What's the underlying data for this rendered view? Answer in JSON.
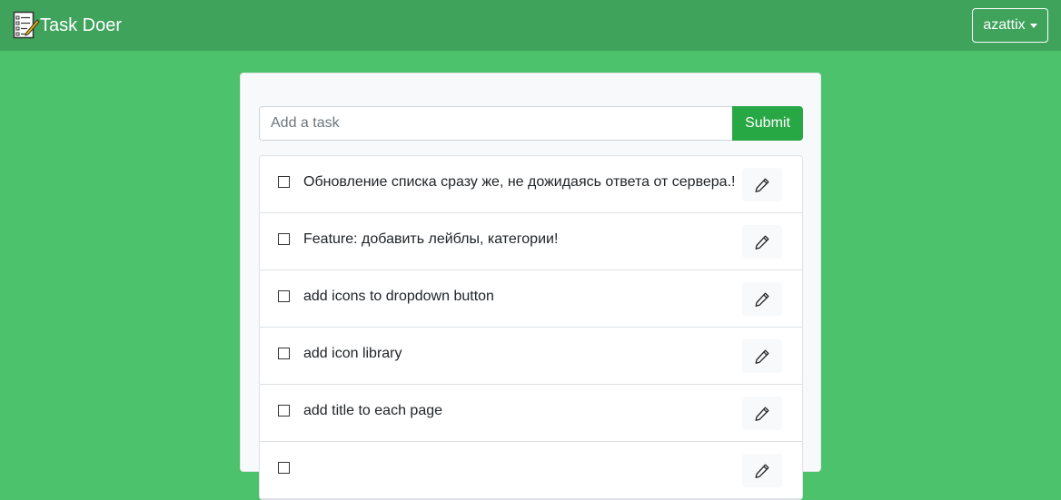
{
  "navbar": {
    "brand": "Task Doer",
    "user": "azattix"
  },
  "form": {
    "placeholder": "Add a task",
    "submit_label": "Submit"
  },
  "tasks": [
    {
      "text": "Обновление списка сразу же, не дожидаясь ответа от сервера.!",
      "done": false
    },
    {
      "text": "Feature: добавить лейблы, категории!",
      "done": false
    },
    {
      "text": "add icons to dropdown button",
      "done": false
    },
    {
      "text": "add icon library",
      "done": false
    },
    {
      "text": "add title to each page",
      "done": false
    },
    {
      "text": "",
      "done": false
    }
  ],
  "icons": {
    "brand": "checklist-pencil-icon",
    "edit": "pencil-icon"
  },
  "colors": {
    "background": "#4bc26b",
    "navbar": "#3fa35c",
    "submit": "#28a745"
  }
}
